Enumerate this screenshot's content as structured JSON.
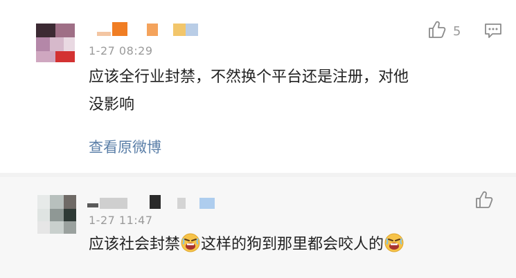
{
  "comments": [
    {
      "time": "1-27 08:29",
      "text_line1": "应该全行业封禁，不然换个平台还是注册，对他",
      "text_line2": "没影响",
      "likes": "5",
      "view_original": "查看原微博",
      "icons": {
        "like": "thumbs-up-icon",
        "reply": "comment-bubble-icon"
      }
    },
    {
      "time": "1-27 11:47",
      "text_part1": "应该社会封禁",
      "text_part2": "这样的狗到那里都会咬人的",
      "emoji": "angry-face-emoji",
      "icons": {
        "like": "thumbs-up-icon"
      }
    }
  ],
  "colors": {
    "link": "#5b7fa8",
    "meta": "#9a9a9a",
    "separator": "#f2f2f2",
    "second_bg": "#f7f7f7"
  }
}
